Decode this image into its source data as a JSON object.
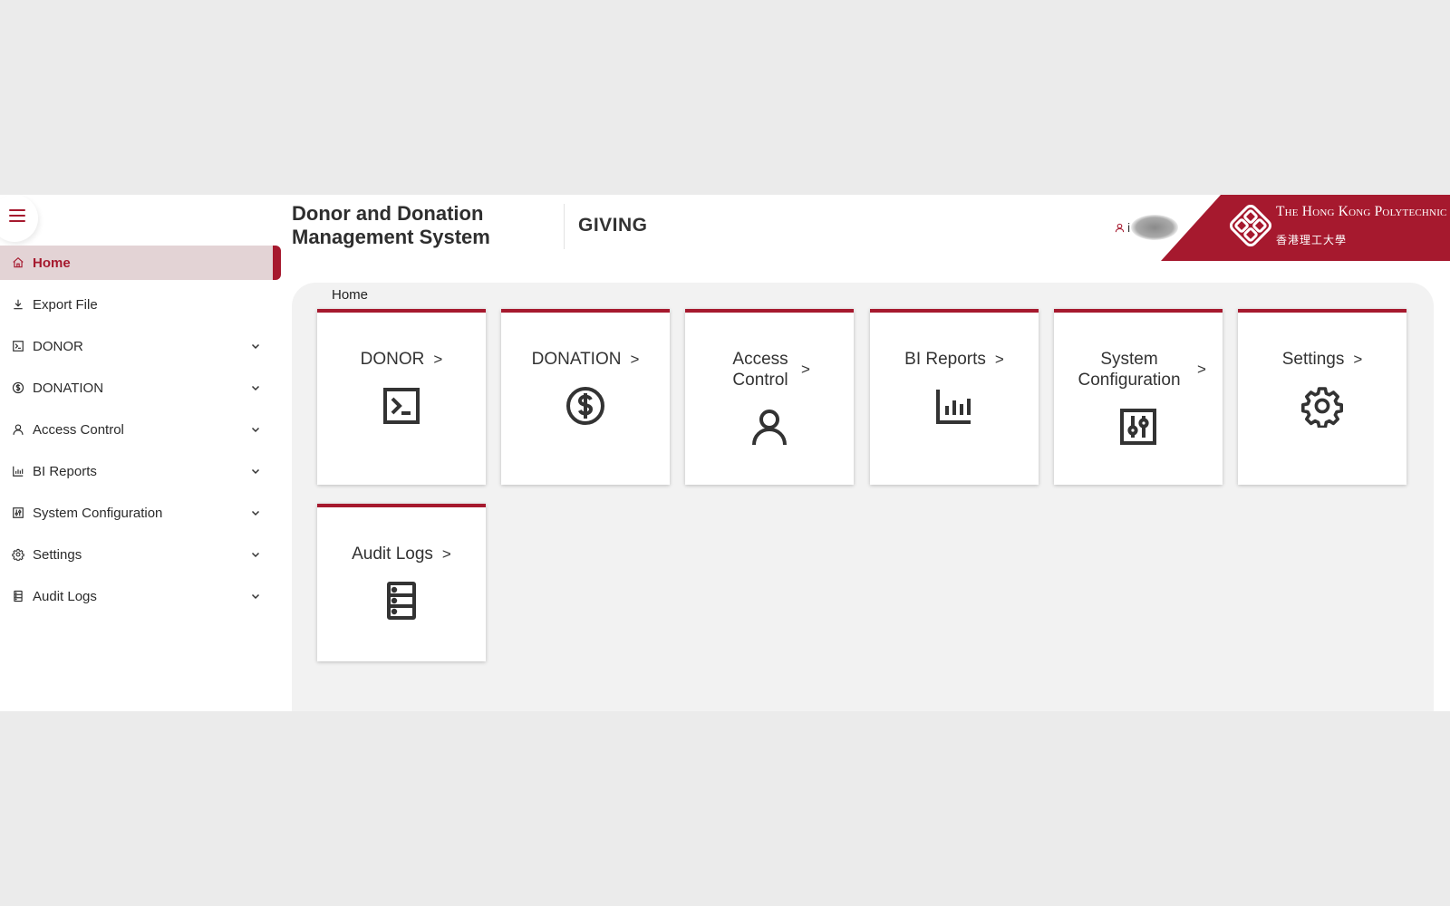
{
  "header": {
    "system_title": "Donor and Donation Management System",
    "app_name": "GIVING",
    "user_initial": "i",
    "brand": {
      "name_en": "The Hong Kong Polytechnic University",
      "name_zh": "香港理工大學",
      "color": "#a6192e"
    }
  },
  "sidebar": {
    "menu_icon": "hamburger-icon",
    "items": [
      {
        "label": "Home",
        "icon": "home-icon",
        "active": true,
        "expandable": false
      },
      {
        "label": "Export File",
        "icon": "download-icon",
        "active": false,
        "expandable": false
      },
      {
        "label": "DONOR",
        "icon": "terminal-icon",
        "active": false,
        "expandable": true
      },
      {
        "label": "DONATION",
        "icon": "dollar-icon",
        "active": false,
        "expandable": true
      },
      {
        "label": "Access Control",
        "icon": "user-icon",
        "active": false,
        "expandable": true
      },
      {
        "label": "BI Reports",
        "icon": "bar-chart-icon",
        "active": false,
        "expandable": true
      },
      {
        "label": "System Configuration",
        "icon": "sliders-icon",
        "active": false,
        "expandable": true
      },
      {
        "label": "Settings",
        "icon": "gear-icon",
        "active": false,
        "expandable": true
      },
      {
        "label": "Audit Logs",
        "icon": "server-icon",
        "active": false,
        "expandable": true
      }
    ]
  },
  "breadcrumb": "Home",
  "cards": [
    {
      "label": "DONOR",
      "icon": "terminal-icon"
    },
    {
      "label": "DONATION",
      "icon": "dollar-icon"
    },
    {
      "label": "Access Control",
      "icon": "user-icon"
    },
    {
      "label": "BI Reports",
      "icon": "bar-chart-icon"
    },
    {
      "label": "System Configuration",
      "icon": "sliders-icon"
    },
    {
      "label": "Settings",
      "icon": "gear-icon"
    },
    {
      "label": "Audit Logs",
      "icon": "server-icon"
    }
  ],
  "colors": {
    "accent": "#a6192e",
    "active_bg": "#e3d3d5",
    "panel_bg": "#f2f2f2",
    "page_bg": "#ebebeb"
  }
}
